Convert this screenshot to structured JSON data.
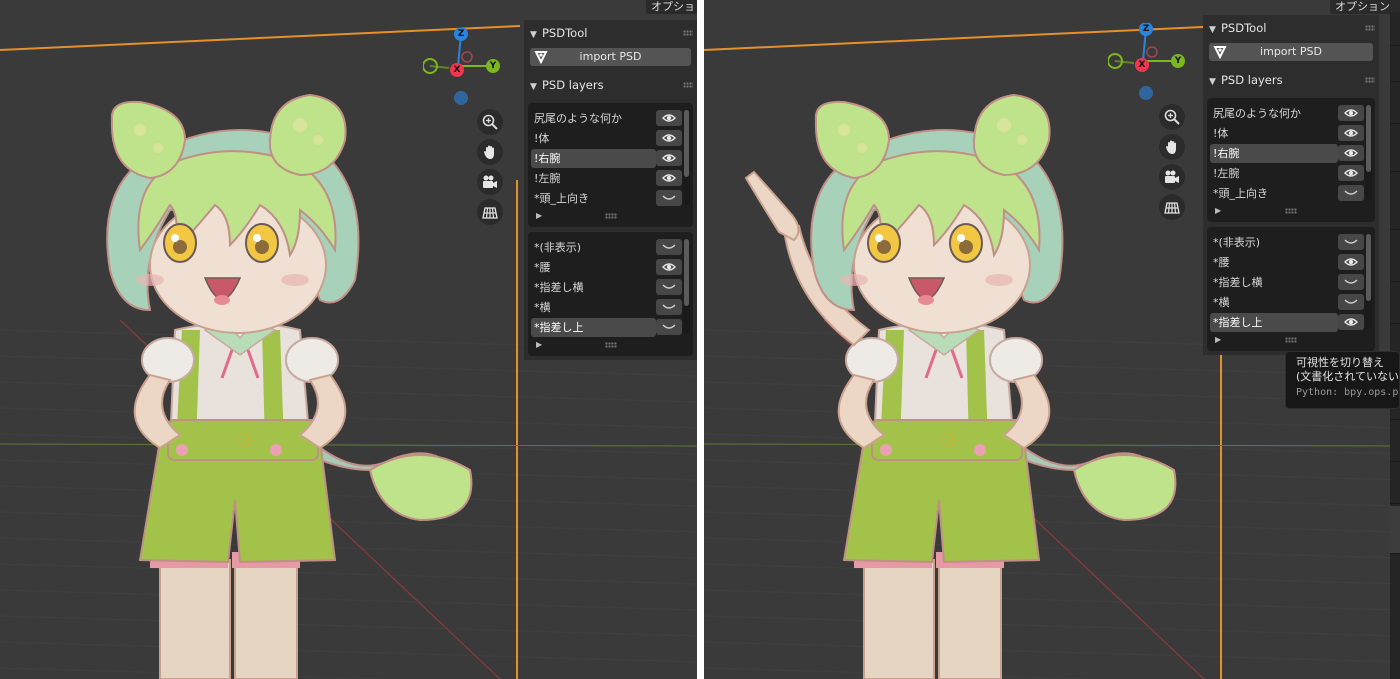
{
  "screens": [
    {
      "id": "left",
      "header_chip": "オプショ",
      "panel": {
        "psdtool_title": "PSDTool",
        "import_label": "import PSD",
        "psd_layers_title": "PSD layers",
        "list1": [
          {
            "label": "尻尾のような何か",
            "visible": true
          },
          {
            "label": "!体",
            "visible": true
          },
          {
            "label": "!右腕",
            "visible": true,
            "selected": true
          },
          {
            "label": "!左腕",
            "visible": true
          },
          {
            "label": "*頭_上向き",
            "visible": false
          }
        ],
        "list2": [
          {
            "label": "*(非表示)",
            "visible": false
          },
          {
            "label": "*腰",
            "visible": true
          },
          {
            "label": "*指差し横",
            "visible": false
          },
          {
            "label": "*横",
            "visible": false
          },
          {
            "label": "*指差し上",
            "visible": false,
            "selected": true
          }
        ]
      },
      "pointing_arm": false
    },
    {
      "id": "right",
      "header_chip": "オプション",
      "panel": {
        "psdtool_title": "PSDTool",
        "import_label": "import PSD",
        "psd_layers_title": "PSD layers",
        "list1": [
          {
            "label": "尻尾のような何か",
            "visible": true
          },
          {
            "label": "!体",
            "visible": true
          },
          {
            "label": "!右腕",
            "visible": true,
            "selected": true
          },
          {
            "label": "!左腕",
            "visible": true
          },
          {
            "label": "*頭_上向き",
            "visible": false
          }
        ],
        "list2": [
          {
            "label": "*(非表示)",
            "visible": false
          },
          {
            "label": "*腰",
            "visible": true
          },
          {
            "label": "*指差し横",
            "visible": false
          },
          {
            "label": "*横",
            "visible": false
          },
          {
            "label": "*指差し上",
            "visible": true,
            "selected": true
          }
        ]
      },
      "pointing_arm": true,
      "tooltip": {
        "line1": "可視性を切り替え",
        "line2": "(文書化されていない",
        "line3": "Python: bpy.ops.p"
      }
    }
  ],
  "gizmo": {
    "z": "Z",
    "x": "X",
    "y": "Y"
  },
  "colors": {
    "viewport_bg": "#3a3a3a",
    "panel_bg": "#2d2d2d",
    "axis_x": "#f0364f",
    "axis_y": "#7bb71f",
    "axis_z": "#2b83de",
    "horizon": "#e7902a",
    "hair": "#bfe38a",
    "overalls": "#a2c24a"
  }
}
